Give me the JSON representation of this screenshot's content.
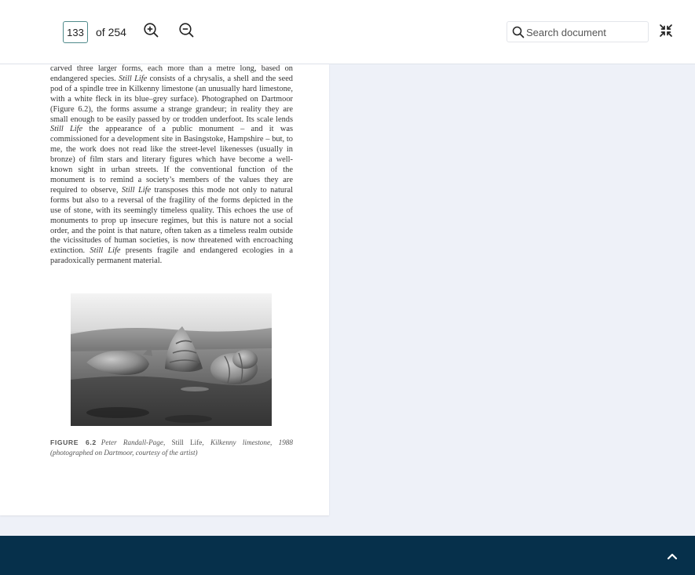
{
  "toolbar": {
    "page_number": "133",
    "page_of": "of 254",
    "zoom_in_icon": "zoom-in-icon",
    "zoom_out_icon": "zoom-out-icon",
    "search_placeholder": "Search document",
    "collapse_icon": "collapse-icon"
  },
  "document": {
    "paragraph": [
      {
        "t": "carved three larger forms, each more than a metre long, based on endangered species. "
      },
      {
        "t": "Still Life",
        "i": true
      },
      {
        "t": " consists of a chrysalis, a shell and the seed pod of a spindle tree in Kilkenny limestone (an unusually hard limestone, with a white fleck in its blue–grey surface). Photographed on Dartmoor (Figure 6.2), the forms assume a strange grandeur; in reality they are small enough to be easily passed by or trodden underfoot. Its scale lends "
      },
      {
        "t": "Still Life",
        "i": true
      },
      {
        "t": " the appearance of a public monument – and it was commissioned for a development site in Basingstoke, Hampshire – but, to me, the work does not read like the street-level likenesses (usually in bronze) of film stars and literary figures which have become a well-known sight in urban streets. If the conventional function of the monument is to remind a society’s members of the values they are required to observe, "
      },
      {
        "t": "Still Life",
        "i": true
      },
      {
        "t": " transposes this mode not only to natural forms but also to a reversal of the fragility of the forms depicted in the use of stone, with its seemingly timeless quality. This echoes the use of monuments to prop up insecure regimes, but this is nature not a social order, and the point is that nature, often taken as a timeless realm outside the vicissitudes of human societies, is now threatened with encroaching extinction. "
      },
      {
        "t": "Still Life",
        "i": true
      },
      {
        "t": " presents fragile and endangered ecologies in a paradoxically permanent material."
      }
    ],
    "figure_label": "FIGURE 6.2",
    "caption_1": "Peter Randall-Page, ",
    "caption_2": "Still Life",
    "caption_3": ", Kilkenny limestone, 1988 (photographed on Dartmoor, courtesy of the artist)"
  },
  "footer": {
    "expand_icon": "chevron-up-icon"
  },
  "colors": {
    "background": "#eef1f8",
    "page": "#ffffff",
    "input_border": "#4f8a8b",
    "footer": "#06304b"
  }
}
